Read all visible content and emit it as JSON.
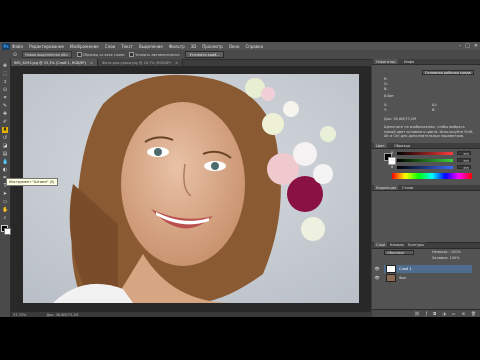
{
  "menubar": {
    "logo": "Ps",
    "items": [
      "Файл",
      "Редактирование",
      "Изображение",
      "Слои",
      "Текст",
      "Выделение",
      "Фильтр",
      "3D",
      "Просмотр",
      "Окно",
      "Справка"
    ],
    "window_controls": [
      "–",
      "□",
      "✕"
    ]
  },
  "options": {
    "mode_label": "Новая выделенная обл.",
    "sample_all_layers": "Образец со всех слоев",
    "auto_enhance": "Усилить автоматически",
    "refine_edge": "Уточнить край...",
    "workspace": "Основная рабочая среда"
  },
  "tabs": [
    {
      "label": "IMG_8293.jpg @ 33,3% (Слой 1, RGB/8*)",
      "active": true
    },
    {
      "label": "Фото-для-урока.jpg @ 16,7% (RGB/8*)",
      "active": false
    }
  ],
  "tooltip": "Инструмент \"Штамп\" (S)",
  "status": {
    "zoom": "33,33%",
    "doc": "Док: 36,6M/73,2M"
  },
  "right_panel": {
    "tabs": [
      "Навигатор",
      "Инфо"
    ],
    "preset": "Основная рабочая среда",
    "info_lines": [
      "R:",
      "G:",
      "B:",
      "8-бит",
      "X:",
      "Y:",
      "Ш:",
      "В:",
      "Док: 36,6M/73,2M"
    ],
    "hint": "Щелкните на изображении, чтобы выбрать новый цвет основного цвета. Используйте Shift, Alt и Ctrl для дополнительных параметров.",
    "color_tabs": [
      "Цвет",
      "Образцы"
    ],
    "sliders": [
      {
        "label": "R",
        "value": "255",
        "color": "#ff3b3b"
      },
      {
        "label": "G",
        "value": "255",
        "color": "#3bd13b"
      },
      {
        "label": "B",
        "value": "255",
        "color": "#3b6bff"
      }
    ],
    "adjust_tabs": [
      "Коррекция",
      "Стили"
    ],
    "layers_tabs": [
      "Слои",
      "Каналы",
      "Контуры"
    ],
    "blend_mode": "Обычные",
    "opacity": "Непрозр.: 100%",
    "fill": "Заливка: 100%",
    "layers": [
      {
        "name": "Слой 1",
        "selected": true
      },
      {
        "name": "Фон",
        "selected": false
      }
    ]
  },
  "colors": {
    "accent": "#4d6c8e",
    "tool_selected": "#e6b200",
    "panel": "#535353",
    "canvas_bg": "#282828"
  }
}
